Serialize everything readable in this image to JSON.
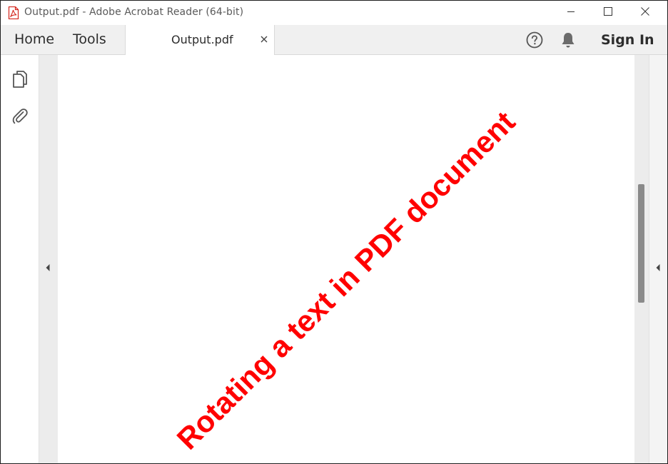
{
  "window": {
    "title": "Output.pdf - Adobe Acrobat Reader (64-bit)",
    "app_icon": "pdf-file-icon",
    "controls": [
      "minimize-icon",
      "maximize-icon",
      "close-icon"
    ]
  },
  "menu": {
    "home_label": "Home",
    "tools_label": "Tools",
    "tab_label": "Output.pdf",
    "tab_close_icon": "close-icon",
    "help_icon": "help-icon",
    "notifications_icon": "bell-icon",
    "signin_label": "Sign In"
  },
  "left_rail": {
    "icons": [
      "page-thumbnails-icon",
      "attachment-icon"
    ]
  },
  "document": {
    "text": "Rotating a text in PDF document",
    "text_color": "#ff0000",
    "rotation_degrees": 45
  },
  "colors": {
    "toolbar_bg": "#f0f0f0",
    "accent_red": "#ff0000"
  }
}
